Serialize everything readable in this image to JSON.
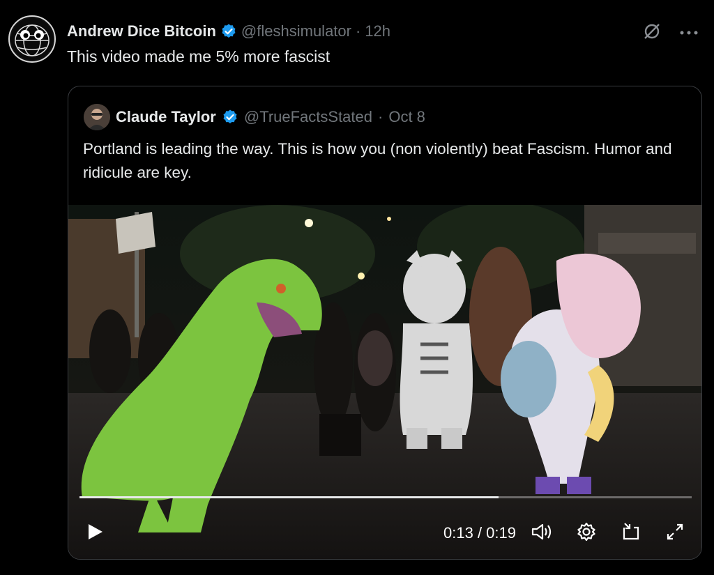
{
  "tweet": {
    "author_name": "Andrew Dice Bitcoin",
    "handle": "@fleshsimulator",
    "separator": "·",
    "time": "12h",
    "text": "This video made me 5% more fascist"
  },
  "quoted": {
    "author_name": "Claude Taylor",
    "handle": "@TrueFactsStated",
    "separator": "·",
    "date": "Oct 8",
    "text": "Portland is leading the way. This is how you (non violently) beat Fascism. Humor and ridicule are key."
  },
  "video": {
    "time_display": "0:13 / 0:19",
    "progress_fraction": 0.684
  },
  "colors": {
    "verified": "#1d9bf0",
    "muted": "#71767b",
    "text": "#e7e9ea"
  },
  "icons": [
    "verified-badge-icon",
    "grok-icon",
    "more-icon",
    "play-icon",
    "volume-icon",
    "settings-icon",
    "pip-icon",
    "fullscreen-icon"
  ]
}
